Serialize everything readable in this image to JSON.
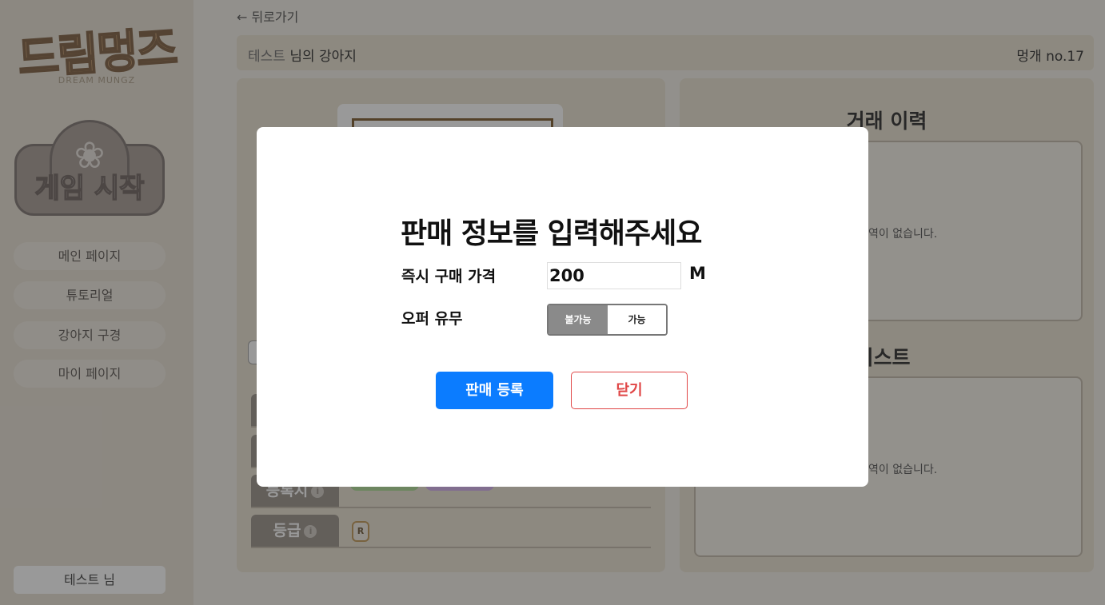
{
  "sidebar": {
    "logo_text": "드림멍즈",
    "logo_sub": "DREAM MUNGZ",
    "game_start": "게임 시작",
    "nav": [
      {
        "label": "메인 페이지"
      },
      {
        "label": "튜토리얼"
      },
      {
        "label": "강아지 구경"
      },
      {
        "label": "마이 페이지"
      }
    ],
    "user": "테스트 님"
  },
  "main": {
    "back_label": "← 뒤로가기",
    "owner_name": "테스트",
    "owner_suffix": " 님의 강아지",
    "dog_no": "멍개 no.17",
    "rows": {
      "owner_label": "등록지",
      "grade_label": "등급",
      "grade_value": "R"
    },
    "right": {
      "trade_title": "거래 이력",
      "trade_empty": "역이 없습니다.",
      "offer_title": "리스트",
      "offer_empty": "역이 없습니다."
    }
  },
  "modal": {
    "title": "판매 정보를 입력해주세요",
    "price_label": "즉시 구매 가격",
    "price_value": "200",
    "unit": "M",
    "offer_label": "오퍼 유무",
    "offer_options": [
      "불가능",
      "가능"
    ],
    "offer_selected": "불가능",
    "register_label": "판매 등록",
    "close_label": "닫기"
  }
}
